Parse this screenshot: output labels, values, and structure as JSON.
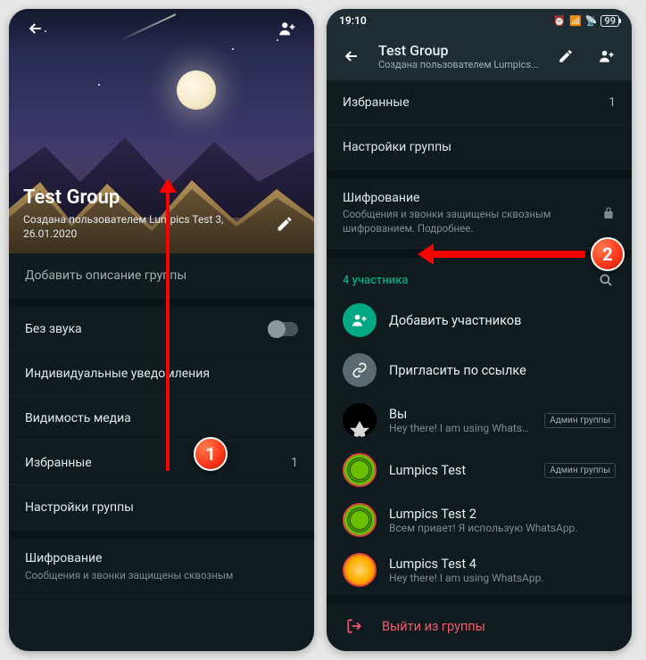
{
  "status": {
    "time": "19:10",
    "battery": "99"
  },
  "left": {
    "back": "←",
    "add_person": "+",
    "group_name": "Test Group",
    "created": "Создана пользователем Lumpics Test 3, 26.01.2020",
    "add_desc": "Добавить описание группы",
    "mute": "Без звука",
    "custom_notif": "Индивидуальные уведомления",
    "media_vis": "Видимость медиа",
    "starred": "Избранные",
    "starred_count": "1",
    "group_settings": "Настройки группы",
    "encryption": "Шифрование",
    "encryption_sub": "Сообщения и звонки защищены сквозным"
  },
  "right": {
    "title": "Test Group",
    "subtitle": "Создана пользователем Lumpics...",
    "starred": "Избранные",
    "starred_count": "1",
    "group_settings": "Настройки группы",
    "encryption": "Шифрование",
    "encryption_sub": "Сообщения и звонки защищены сквозным шифрованием. Подробнее.",
    "participants_label": "4 участника",
    "add_participants": "Добавить участников",
    "invite_link": "Пригласить по ссылке",
    "members": [
      {
        "name": "Вы",
        "status": "Hey there! I am using WhatsApp.",
        "admin": "Админ группы"
      },
      {
        "name": "Lumpics Test",
        "status": "",
        "admin": "Админ группы"
      },
      {
        "name": "Lumpics Test 2",
        "status": "Всем привет! Я использую WhatsApp.",
        "admin": ""
      },
      {
        "name": "Lumpics Test 4",
        "status": "Hey there! I am using WhatsApp.",
        "admin": ""
      }
    ],
    "exit": "Выйти из группы"
  },
  "annotations": {
    "badge1": "1",
    "badge2": "2"
  }
}
